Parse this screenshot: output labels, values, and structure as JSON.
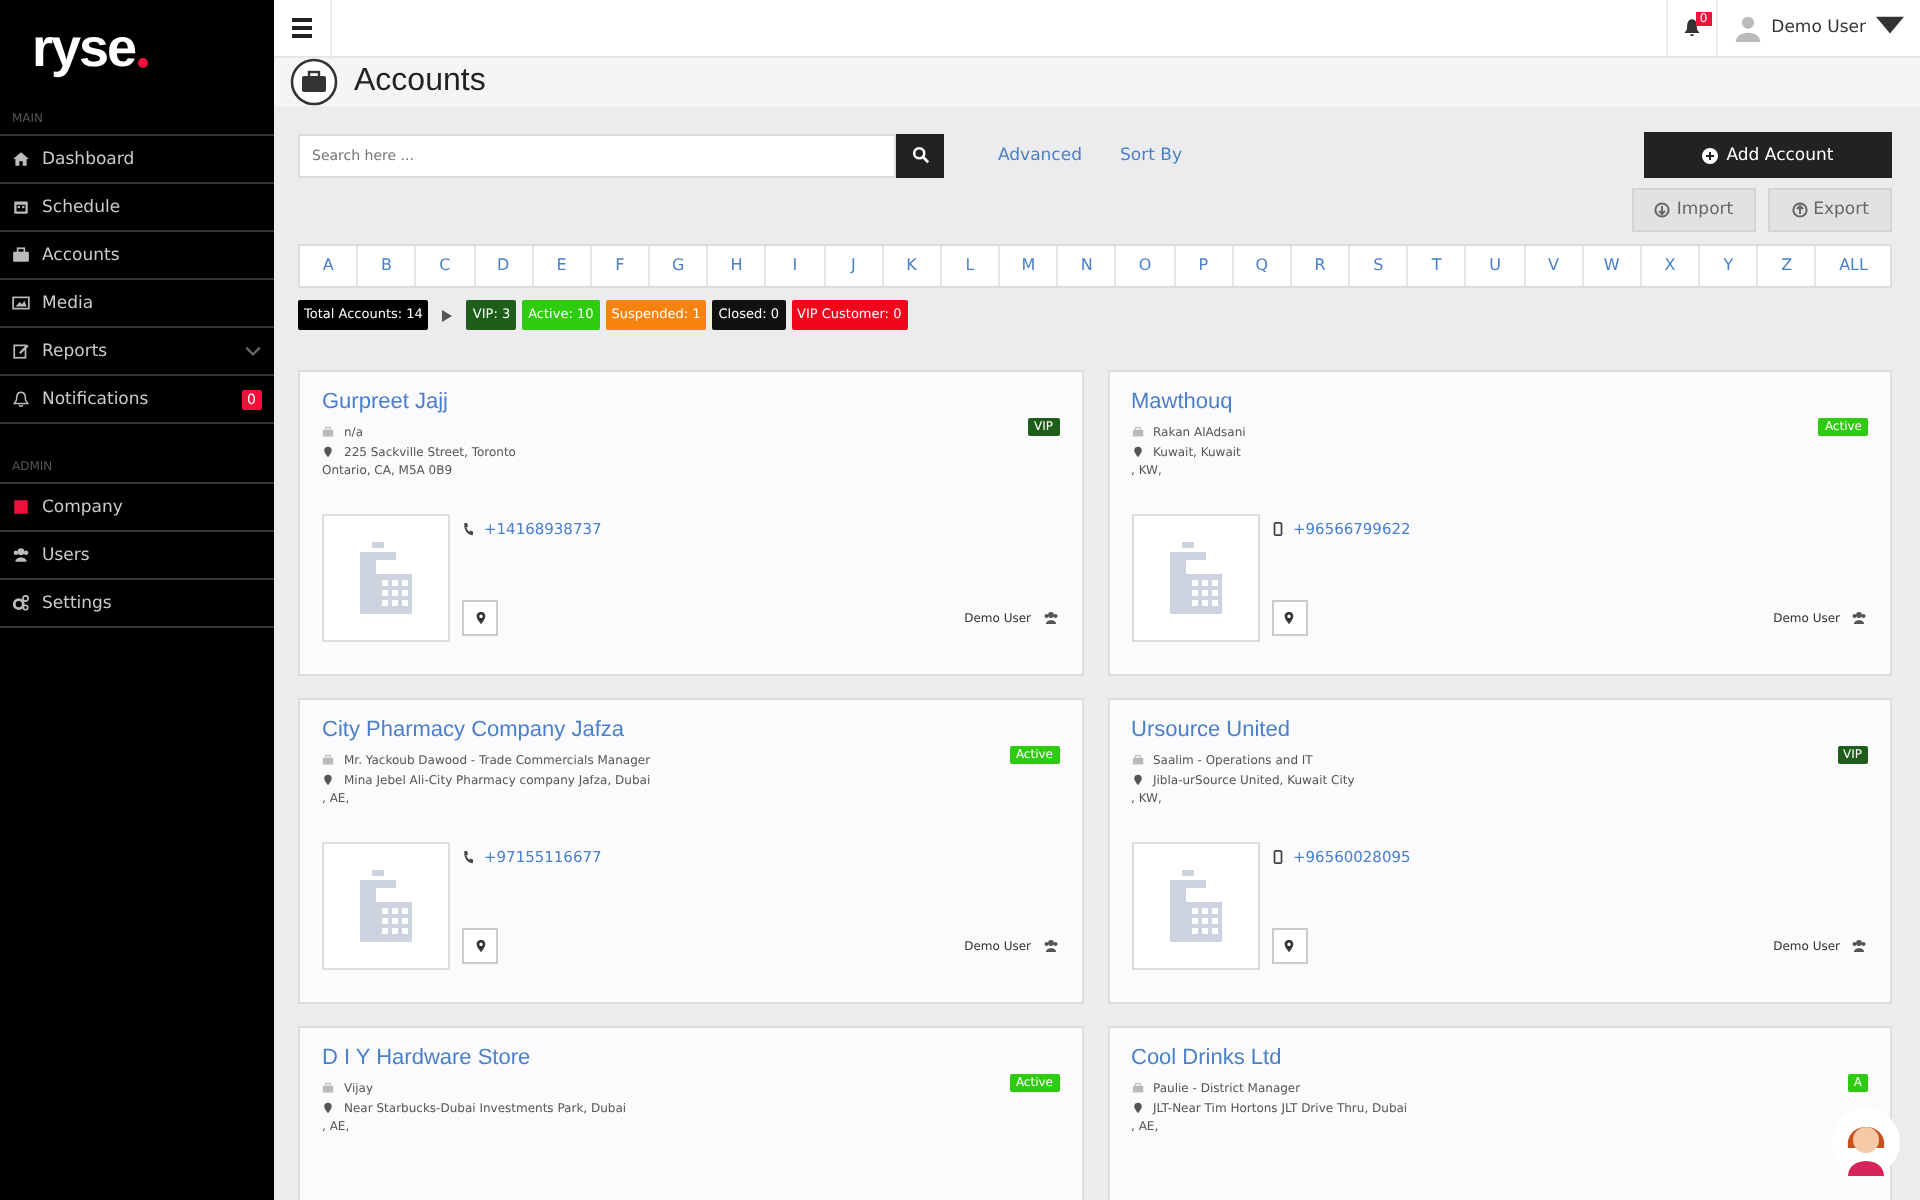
{
  "sidebar": {
    "logo": "ryse",
    "sections": [
      {
        "label": "MAIN",
        "items": [
          {
            "label": "Dashboard",
            "kind": "link"
          },
          {
            "label": "Schedule",
            "kind": "link"
          },
          {
            "label": "Accounts",
            "kind": "link"
          },
          {
            "label": "Media",
            "kind": "link"
          },
          {
            "label": "Reports",
            "kind": "submenu"
          },
          {
            "label": "Notifications",
            "kind": "badge",
            "badge": "0"
          }
        ]
      },
      {
        "label": "ADMIN",
        "items": [
          {
            "label": "Company",
            "kind": "link"
          },
          {
            "label": "Users",
            "kind": "link"
          },
          {
            "label": "Settings",
            "kind": "link"
          }
        ]
      }
    ]
  },
  "topbar": {
    "notification_count": "0",
    "user": "Demo User"
  },
  "page": {
    "title": "Accounts"
  },
  "toolbar": {
    "search": {
      "placeholder": "Search here ..."
    },
    "links": [
      "Advanced",
      "Sort By"
    ],
    "add_button": "Add Account",
    "import_button": "Import",
    "export_button": "Export"
  },
  "alphabet": [
    "A",
    "B",
    "C",
    "D",
    "E",
    "F",
    "G",
    "H",
    "I",
    "J",
    "K",
    "L",
    "M",
    "N",
    "O",
    "P",
    "Q",
    "R",
    "S",
    "T",
    "U",
    "V",
    "W",
    "X",
    "Y",
    "Z",
    "ALL"
  ],
  "stats": {
    "total": "Total Accounts: 14",
    "chips": [
      {
        "label": "VIP: 3",
        "color": "#1e5e1a"
      },
      {
        "label": "Active: 10",
        "color": "#2ecc0e"
      },
      {
        "label": "Suspended: 1",
        "color": "#f7830f"
      },
      {
        "label": "Closed: 0",
        "color": "#111111"
      },
      {
        "label": "VIP Customer: 0",
        "color": "#f2061c"
      }
    ]
  },
  "accounts": [
    {
      "name": "Gurpreet Jajj",
      "contact": "n/a",
      "address": "225 Sackville Street, Toronto",
      "region": "Ontario, CA, M5A 0B9",
      "status": "VIP",
      "color": "#1e5e1a",
      "phone": "+14168938737",
      "kind": "landline",
      "owner": "Demo User"
    },
    {
      "name": "Mawthouq",
      "contact": "Rakan AlAdsani",
      "address": "Kuwait, Kuwait",
      "region": ", KW,",
      "status": "Active",
      "color": "#2ecc0e",
      "phone": "+96566799622",
      "kind": "mobile",
      "owner": "Demo User"
    },
    {
      "name": "City Pharmacy Company Jafza",
      "contact": "Mr. Yackoub Dawood - Trade Commercials Manager",
      "address": "Mina Jebel Ali-City Pharmacy company Jafza, Dubai",
      "region": ", AE,",
      "status": "Active",
      "color": "#2ecc0e",
      "phone": "+97155116677",
      "kind": "landline",
      "owner": "Demo User"
    },
    {
      "name": "Ursource United",
      "contact": "Saalim - Operations and IT",
      "address": "Jibla-urSource United, Kuwait City",
      "region": ", KW,",
      "status": "VIP",
      "color": "#1e5e1a",
      "phone": "+96560028095",
      "kind": "mobile",
      "owner": "Demo User"
    },
    {
      "name": "D I Y Hardware Store",
      "contact": "Vijay",
      "address": "Near Starbucks-Dubai Investments Park, Dubai",
      "region": ", AE,",
      "status": "Active",
      "color": "#2ecc0e"
    },
    {
      "name": "Cool Drinks Ltd",
      "contact": "Paulie - District Manager",
      "address": "JLT-Near Tim Hortons JLT Drive Thru, Dubai",
      "region": ", AE,",
      "status": "A",
      "color": "#2ecc0e"
    }
  ]
}
